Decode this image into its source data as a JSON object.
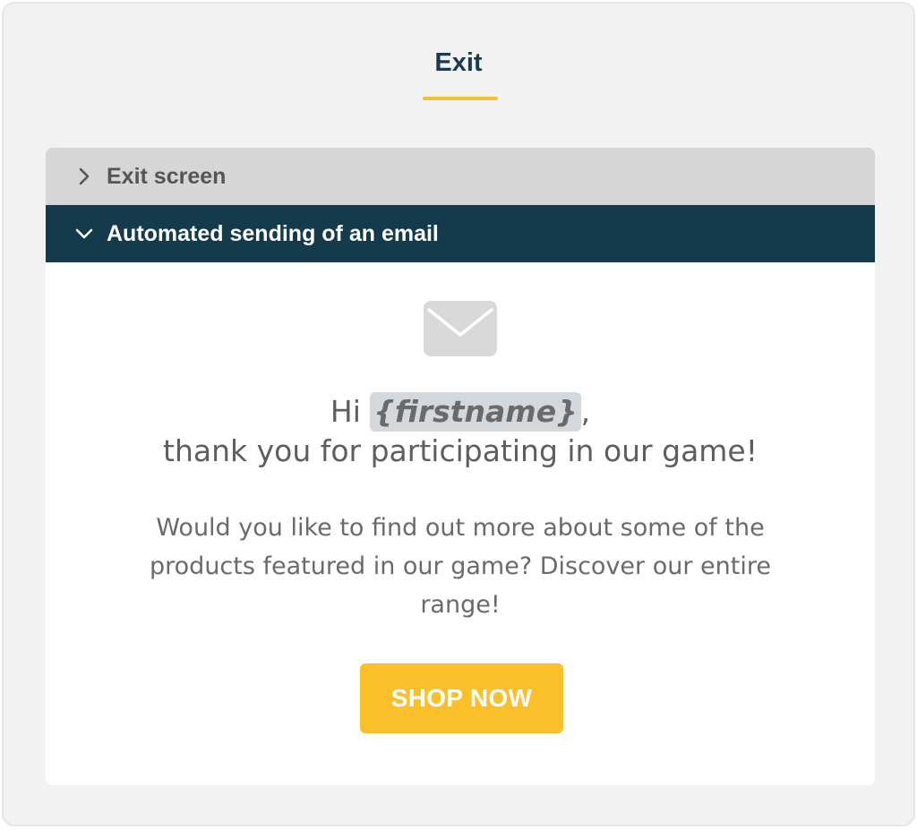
{
  "header": {
    "title": "Exit"
  },
  "accordion": {
    "sections": [
      {
        "label": "Exit screen",
        "state": "collapsed"
      },
      {
        "label": "Automated sending of an email",
        "state": "expanded"
      }
    ]
  },
  "email": {
    "icon": "envelope-icon",
    "greeting_prefix": "Hi ",
    "variable": "{firstname}",
    "greeting_suffix": ",",
    "greeting_line2": "thank you for participating in our game!",
    "body": "Would you like to find out more about some of the products featured in our game? Discover our entire range!",
    "cta_label": "SHOP NOW"
  },
  "colors": {
    "accent": "#f6c02b",
    "header_dark": "#143a4c",
    "collapsed_bg": "#d6d6d6",
    "cta_bg": "#f9c02a"
  }
}
